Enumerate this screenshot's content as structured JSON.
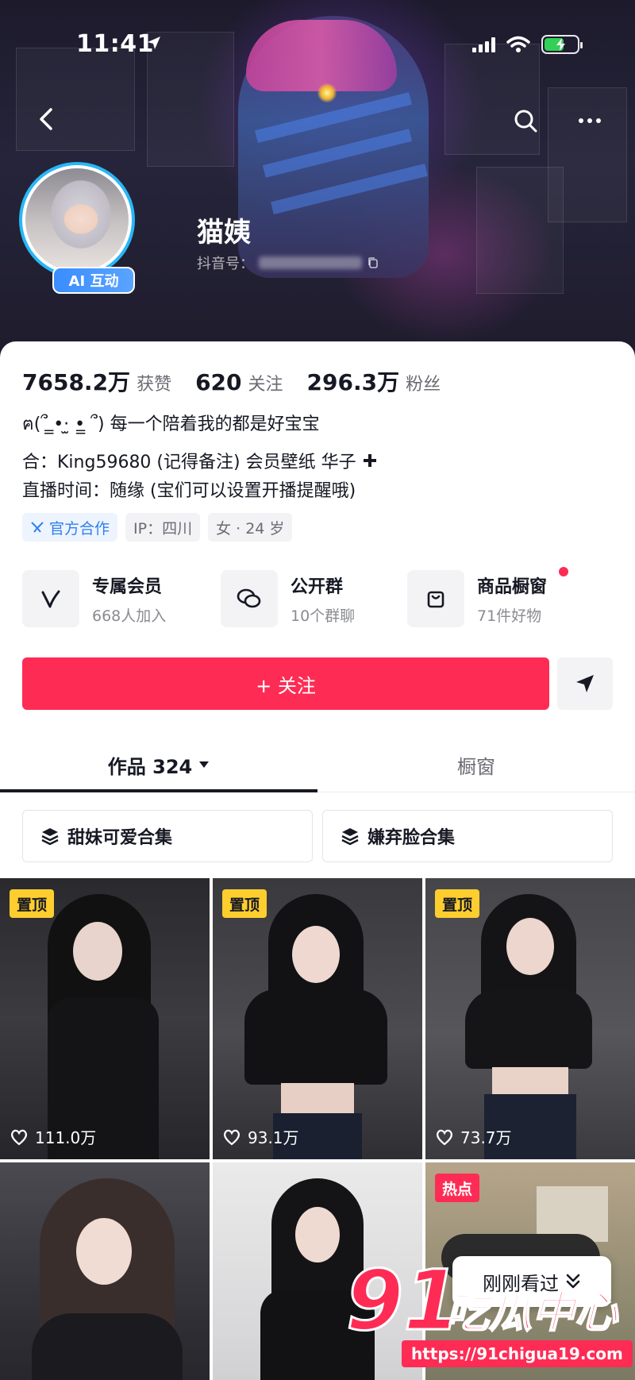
{
  "status_bar": {
    "time": "11:41"
  },
  "profile": {
    "nickname": "猫姨",
    "douyin_id_label": "抖音号：",
    "ai_badge": "AI 互动"
  },
  "stats": [
    {
      "value": "7658.2万",
      "label": "获赞"
    },
    {
      "value": "620",
      "label": "关注"
    },
    {
      "value": "296.3万",
      "label": "粉丝"
    }
  ],
  "bio": {
    "line1": "ฅ(՞ ̳•·̫ •̳ ՞) 每一个陪着我的都是好宝宝",
    "line2": "合：King59680 (记得备注) 会员壁纸 华子",
    "line3": "直播时间：随缘 (宝们可以设置开播提醒哦)"
  },
  "tags": [
    {
      "label": "官方合作"
    },
    {
      "label": "IP：四川"
    },
    {
      "label": "女 · 24 岁"
    }
  ],
  "features": [
    {
      "title": "专属会员",
      "subtitle": "668人加入",
      "icon": "member-v-icon"
    },
    {
      "title": "公开群",
      "subtitle": "10个群聊",
      "icon": "chat-bubbles-icon"
    },
    {
      "title": "商品橱窗",
      "subtitle": "71件好物",
      "icon": "shopping-bag-icon"
    }
  ],
  "actions": {
    "follow_label": "+ 关注"
  },
  "tabs": [
    {
      "label": "作品 324"
    },
    {
      "label": "橱窗"
    }
  ],
  "collections": [
    {
      "label": "甜妹可爱合集"
    },
    {
      "label": "嫌弃脸合集"
    }
  ],
  "videos": [
    {
      "badge": "置顶",
      "likes": "111.0万"
    },
    {
      "badge": "置顶",
      "likes": "93.1万"
    },
    {
      "badge": "置顶",
      "likes": "73.7万"
    },
    {
      "badge": "",
      "likes": ""
    },
    {
      "badge": "",
      "likes": ""
    },
    {
      "badge": "热点",
      "likes": ""
    }
  ],
  "recent_pill": {
    "label": "刚刚看过"
  },
  "watermark": {
    "number": "91",
    "text": "吃瓜中心",
    "url": "https://91chigua19.com"
  },
  "colors": {
    "accent": "#fe2c55",
    "pin_badge": "#fece2f",
    "official": "#2f80ed",
    "avatar_ring": "#29b6f6"
  }
}
